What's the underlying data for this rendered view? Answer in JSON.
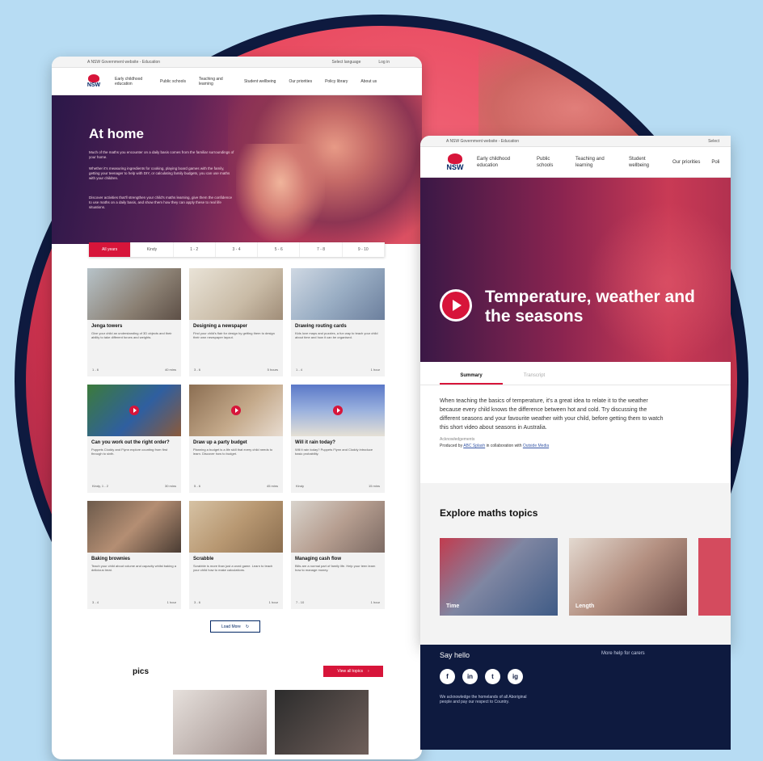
{
  "left_page": {
    "topbar": {
      "site": "A NSW Government website - Education",
      "language": "Select language",
      "login": "Log in"
    },
    "logo": "NSW",
    "nav": [
      "Early childhood education",
      "Public schools",
      "Teaching and learning",
      "Student wellbeing",
      "Our priorities",
      "Policy library",
      "About us"
    ],
    "hero": {
      "title": "At home",
      "p1": "Much of the maths you encounter on a daily basis comes from the familiar surroundings of your home.",
      "p2": "Whether it's measuring ingredients for cooking, playing board games with the family, getting your teenager to help with DIY, or calculating family budgets, you can use maths with your children.",
      "p3": "Discover activities that'll strengthen your child's maths learning, give them the confidence to use maths on a daily basis, and show them how they can apply these to real life situations."
    },
    "tabs": [
      "All years",
      "Kindy",
      "1 - 2",
      "3 - 4",
      "5 - 6",
      "7 - 8",
      "9 - 10"
    ],
    "tiles": [
      {
        "title": "Jenga towers",
        "desc": "Give your child an understanding of 3D objects and their ability to take different forces and weights.",
        "years": "1 - 6",
        "time": "40 mins"
      },
      {
        "title": "Designing a newspaper",
        "desc": "Find your child's flair for design by getting them to design their own newspaper layout.",
        "years": "3 - 6",
        "time": "5 hours"
      },
      {
        "title": "Drawing routing cards",
        "desc": "Kids love maps and puzzles, a fun way to teach your child about time and how it can be organised.",
        "years": "1 - 4",
        "time": "1 hour"
      },
      {
        "title": "Can you work out the right order?",
        "desc": "Puppets Cloddy and Flynn explore counting from first through to sixth.",
        "years": "Kindy, 1 - 2",
        "time": "30 mins"
      },
      {
        "title": "Draw up a party budget",
        "desc": "Planning a budget is a life skill that every child needs to learn. Discover how to budget.",
        "years": "5 - 6",
        "time": "45 mins"
      },
      {
        "title": "Will it rain today?",
        "desc": "Will it rain today? Puppets Flynn and Cloddy introduce basic probability.",
        "years": "Kindy",
        "time": "15 mins"
      },
      {
        "title": "Baking brownies",
        "desc": "Teach your child about volume and capacity whilst baking a delicious treat.",
        "years": "3 - 4",
        "time": "1 hour"
      },
      {
        "title": "Scrabble",
        "desc": "Scrabble is more than just a word game. Learn to teach your child how to make calculations.",
        "years": "3 - 6",
        "time": "1 hour"
      },
      {
        "title": "Managing cash flow",
        "desc": "Bills are a normal part of family life. Help your teen learn how to manage money.",
        "years": "7 - 10",
        "time": "1 hour"
      }
    ],
    "load_more": "Load More",
    "topics_heading": "pics",
    "view_all": "View all topics"
  },
  "right_page": {
    "topbar": {
      "site": "A NSW Government website - Education",
      "select": "Select"
    },
    "logo": "NSW",
    "nav": [
      "Early childhood education",
      "Public schools",
      "Teaching and learning",
      "Student wellbeing",
      "Our priorities",
      "Poli"
    ],
    "hero_title": "Temperature, weather and the seasons",
    "tabs": [
      "Summary",
      "Transcript"
    ],
    "body": "When teaching the basics of temperature, it's a great idea to relate it to the weather because every child knows the difference between hot and cold. Try discussing the different seasons and your favourite weather with your child, before getting them to watch this short video about seasons in Australia.",
    "ack_label": "Acknowledgements",
    "produced_prefix": "Produced by",
    "produced_link1": "ABC Splash",
    "produced_mid": "in collaboration with",
    "produced_link2": "Outside Media",
    "explore_heading": "Explore maths topics",
    "topics": [
      "Time",
      "Length"
    ],
    "footer": {
      "say_hello": "Say hello",
      "socials": [
        "f",
        "in",
        "t",
        "ig"
      ],
      "acknowledgement": "We acknowledge the homelands of all Aboriginal people and pay our respect to Country.",
      "more_help": "More help for carers"
    }
  }
}
